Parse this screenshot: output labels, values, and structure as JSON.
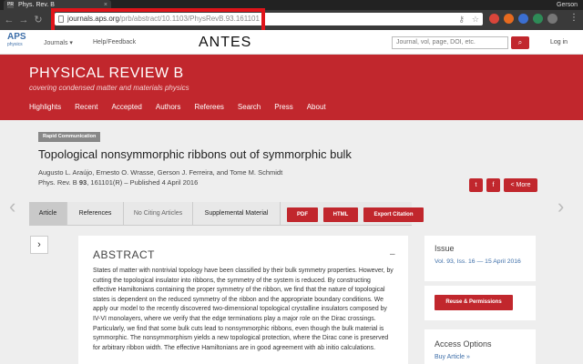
{
  "browser": {
    "tab_title": "Phys. Rev. B",
    "tab_favicon": "PR",
    "tab_close": "×",
    "user": "Gerson",
    "url_host": "journals.aps.org",
    "url_path": "/prb/abstract/10.1103/PhysRevB.93.161101",
    "nav_back": "←",
    "nav_forward": "→",
    "nav_reload": "↻",
    "key_icon": "⚷",
    "star_icon": "☆",
    "menu_icon": "⋮",
    "extensions": [
      {
        "name": "ext-red-icon",
        "color": "#d9453a"
      },
      {
        "name": "ext-orange-icon",
        "color": "#e66a1f"
      },
      {
        "name": "ext-blue-icon",
        "color": "#3b6fd1"
      },
      {
        "name": "ext-green-icon",
        "color": "#2e8b57"
      },
      {
        "name": "ext-gray-icon",
        "color": "#777777"
      }
    ],
    "highlight_color": "#e0141a"
  },
  "site_header": {
    "logo_top": "APS",
    "logo_bottom": "physics",
    "journals": "Journals ▾",
    "help": "Help/Feedback",
    "search_placeholder": "Journal, vol, page, DOI, etc.",
    "search_icon": "⌕",
    "login": "Log in"
  },
  "annotation": "ANTES",
  "banner": {
    "title": "PHYSICAL REVIEW B",
    "subtitle": "covering condensed matter and materials physics",
    "nav": [
      "Highlights",
      "Recent",
      "Accepted",
      "Authors",
      "Referees",
      "Search",
      "Press",
      "About"
    ],
    "color": "#c1272d"
  },
  "article": {
    "badge": "Rapid Communication",
    "title": "Topological nonsymmorphic ribbons out of symmorphic bulk",
    "authors": "Augusto L. Araújo, Ernesto O. Wrasse, Gerson J. Ferreira, and Tome M. Schmidt",
    "citation_prefix": "Phys. Rev. B ",
    "citation_volume": "93",
    "citation_rest": ", 161101(R) – Published 4 April 2016",
    "share": {
      "twitter": "t",
      "facebook": "f",
      "more": "More"
    }
  },
  "tabs": [
    "Article",
    "References",
    "No Citing Articles",
    "Supplemental Material"
  ],
  "action_buttons": [
    "PDF",
    "HTML",
    "Export Citation"
  ],
  "prev_arrow": "‹",
  "next_arrow": "›",
  "side_toggle": "›",
  "abstract": {
    "heading": "ABSTRACT",
    "collapse": "–",
    "text": "States of matter with nontrivial topology have been classified by their bulk symmetry properties. However, by cutting the topological insulator into ribbons, the symmetry of the system is reduced. By constructing effective Hamiltonians containing the proper symmetry of the ribbon, we find that the nature of topological states is dependent on the reduced symmetry of the ribbon and the appropriate boundary conditions. We apply our model to the recently discovered two-dimensional topological crystalline insulators composed by IV-VI monolayers, where we verify that the edge terminations play a major role on the Dirac crossings. Particularly, we find that some bulk cuts lead to nonsymmorphic ribbons, even though the bulk material is symmorphic. The nonsymmorphism yields a new topological protection, where the Dirac cone is preserved for arbitrary ribbon width. The effective Hamiltonians are in good agreement with ab initio calculations."
  },
  "sidebar": {
    "issue_label": "Issue",
    "issue_value": "Vol. 93, Iss. 16 — 15 April 2016",
    "reuse": "Reuse & Permissions",
    "access_label": "Access Options",
    "buy": "Buy Article »"
  }
}
